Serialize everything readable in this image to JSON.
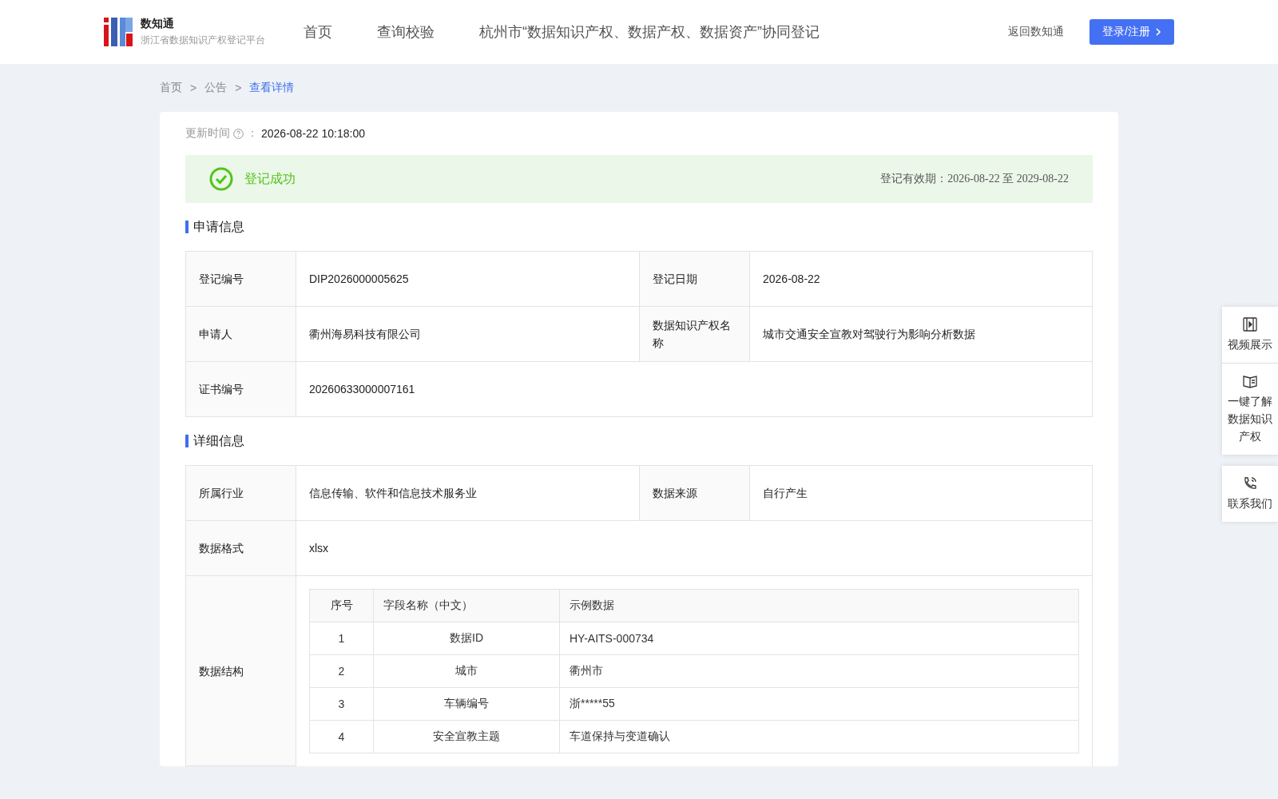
{
  "header": {
    "logo": {
      "name": "数知通",
      "subtitle": "浙江省数据知识产权登记平台"
    },
    "nav": [
      {
        "label": "首页",
        "selected": false
      },
      {
        "label": "查询校验",
        "selected": false
      },
      {
        "label": "杭州市“数据知识产权、数据产权、数据资产”协同登记",
        "selected": false
      }
    ],
    "back_link": "返回数知通",
    "login_button": "登录/注册"
  },
  "breadcrumb": {
    "items": [
      {
        "label": "首页",
        "selected": false
      },
      {
        "label": "公告",
        "selected": false
      },
      {
        "label": "查看详情",
        "selected": true
      }
    ],
    "separators": [
      ">",
      ">"
    ]
  },
  "update": {
    "label": "更新时间",
    "colon": "：",
    "value": "2026-08-22 10:18:00"
  },
  "status": {
    "kind": "success",
    "text": "登记成功",
    "validity": "登记有效期：2026-08-22 至 2029-08-22"
  },
  "sections": [
    {
      "title": "申请信息",
      "rows": [
        [
          {
            "label": "登记编号",
            "value": "DIP2026000005625"
          },
          {
            "label": "登记日期",
            "value": "2026-08-22"
          }
        ],
        [
          {
            "label": "申请人",
            "value": "衢州海易科技有限公司"
          },
          {
            "label": "数据知识产权名称",
            "value": "城市交通安全宣教对驾驶行为影响分析数据"
          }
        ],
        [
          {
            "label": "证书编号",
            "value": "20260633000007161"
          }
        ]
      ]
    },
    {
      "title": "详细信息",
      "rows": [
        [
          {
            "label": "所属行业",
            "value": "信息传输、软件和信息技术服务业"
          },
          {
            "label": "数据来源",
            "value": "自行产生"
          }
        ],
        [
          {
            "label": "数据格式",
            "value": "xlsx"
          }
        ],
        [
          {
            "label": "数据结构",
            "table": {
              "columns": [
                "序号",
                "字段名称（中文）",
                "示例数据"
              ],
              "rows": [
                [
                  "1",
                  "数据ID",
                  "HY-AITS-000734"
                ],
                [
                  "2",
                  "城市",
                  "衢州市"
                ],
                [
                  "3",
                  "车辆编号",
                  "浙*****55"
                ],
                [
                  "4",
                  "安全宣教主题",
                  "车道保持与变道确认"
                ]
              ]
            }
          }
        ]
      ]
    }
  ],
  "float_menu": [
    [
      {
        "kind": "film",
        "label": "视频展示"
      },
      {
        "kind": "book",
        "label": "一键了解数据知识产权"
      }
    ],
    [
      {
        "kind": "phone",
        "label": "联系我们"
      }
    ]
  ]
}
